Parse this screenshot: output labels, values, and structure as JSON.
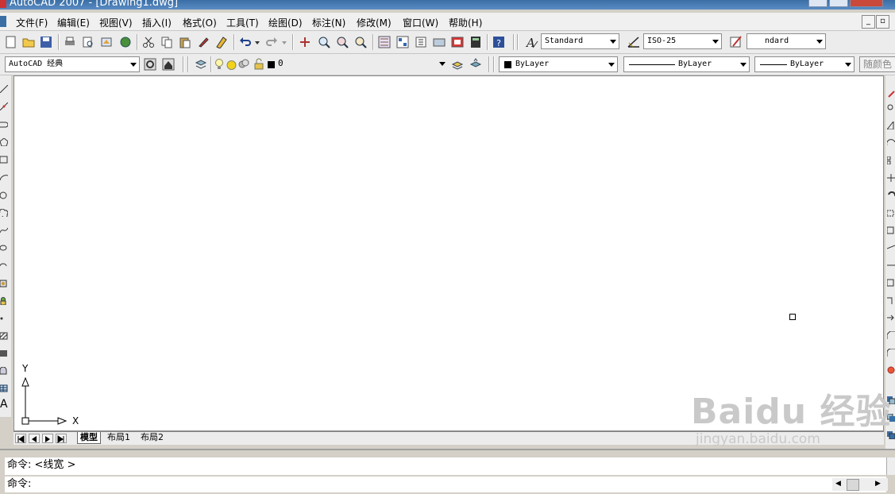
{
  "window": {
    "title": "AutoCAD 2007 - [Drawing1.dwg]"
  },
  "menubar": {
    "items": [
      {
        "label": "文件(F)"
      },
      {
        "label": "编辑(E)"
      },
      {
        "label": "视图(V)"
      },
      {
        "label": "插入(I)"
      },
      {
        "label": "格式(O)"
      },
      {
        "label": "工具(T)"
      },
      {
        "label": "绘图(D)"
      },
      {
        "label": "标注(N)"
      },
      {
        "label": "修改(M)"
      },
      {
        "label": "窗口(W)"
      },
      {
        "label": "帮助(H)"
      }
    ],
    "mdi_minimize": "_",
    "mdi_restore": "▫"
  },
  "standard_toolbar": {
    "text_style": "Standard",
    "dim_style": "ISO-25",
    "table_style": "ndard"
  },
  "workspace_toolbar": {
    "workspace": "AutoCAD 经典",
    "layer": "0",
    "color": "ByLayer",
    "linetype": "ByLayer",
    "lineweight": "ByLayer",
    "plot_style": "随颜色"
  },
  "drawing": {
    "ucs_y": "Y",
    "ucs_x": "X"
  },
  "layout_tabs": {
    "tabs": [
      {
        "label": "模型",
        "active": true
      },
      {
        "label": "布局1",
        "active": false
      },
      {
        "label": "布局2",
        "active": false
      }
    ]
  },
  "command": {
    "history_line": "命令:  <线宽 >",
    "prompt": "命令:"
  },
  "watermark": {
    "brand": "Baidu 经验",
    "url": "jingyan.baidu.com"
  },
  "colors": {
    "title_bar": "#3a6ea5",
    "canvas": "#ffffff",
    "toolbar": "#ececec"
  }
}
